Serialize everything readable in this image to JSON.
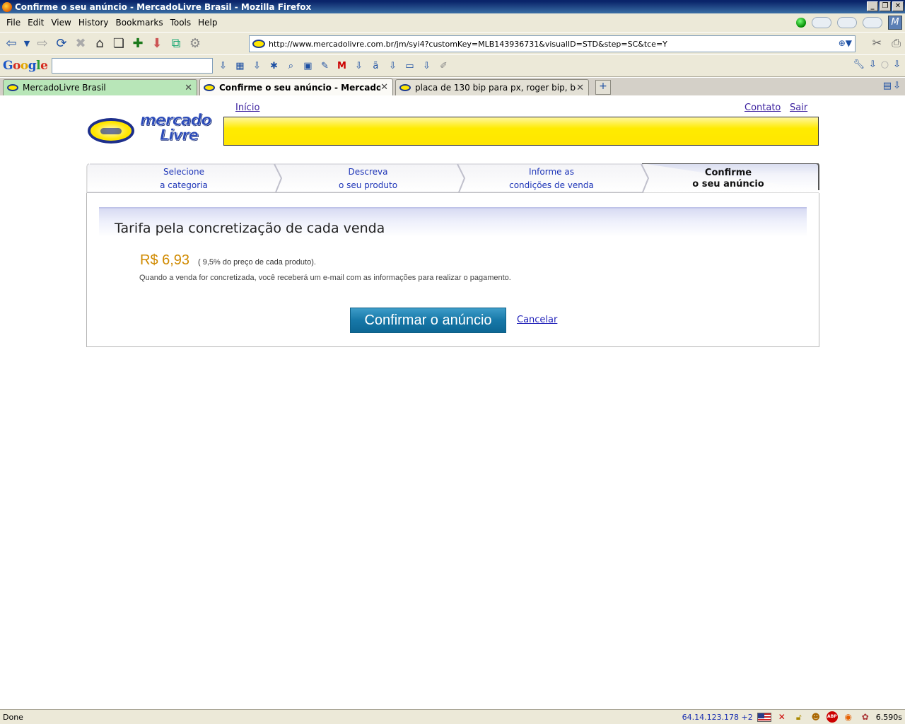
{
  "window": {
    "title": "Confirme o seu anúncio - MercadoLivre Brasil - Mozilla Firefox"
  },
  "menu": {
    "items": [
      "File",
      "Edit",
      "View",
      "History",
      "Bookmarks",
      "Tools",
      "Help"
    ]
  },
  "navigation": {
    "url": "http://www.mercadolivre.com.br/jm/syi4?customKey=MLB143936731&visualID=STD&step=SC&tce=Y"
  },
  "google_toolbar": {
    "logo": "Google",
    "search_value": ""
  },
  "tabs": [
    {
      "label": "MercadoLivre Brasil",
      "active": false
    },
    {
      "label": "Confirme o seu anúncio - MercadoL...",
      "active": true
    },
    {
      "label": "placa de 130 bip para px, roger bip, beep...",
      "active": false
    }
  ],
  "page": {
    "logo_line1": "mercado",
    "logo_line2": "Livre",
    "links": {
      "inicio": "Início",
      "contato": "Contato",
      "sair": "Sair"
    },
    "steps": [
      {
        "line1": "Selecione",
        "line2": "a categoria",
        "active": false
      },
      {
        "line1": "Descreva",
        "line2": "o seu produto",
        "active": false
      },
      {
        "line1": "Informe as",
        "line2": "condições de venda",
        "active": false
      },
      {
        "line1": "Confirme",
        "line2": "o seu anúncio",
        "active": true
      }
    ],
    "fee_title": "Tarifa pela concretização de cada venda",
    "price": "R$ 6,93",
    "price_note": "( 9,5% do preço de cada produto).",
    "info": "Quando a venda for concretizada, você receberá um e-mail com as informações para realizar o pagamento.",
    "confirm_button": "Confirmar o anúncio",
    "cancel_link": "Cancelar"
  },
  "status": {
    "text": "Done",
    "ip": "64.14.123.178 +2",
    "time": "6.590s"
  },
  "colors": {
    "price": "#d08a00",
    "confirm_button": "#1778a8",
    "banner": "#ffe600",
    "link": "#1e1eb8"
  }
}
